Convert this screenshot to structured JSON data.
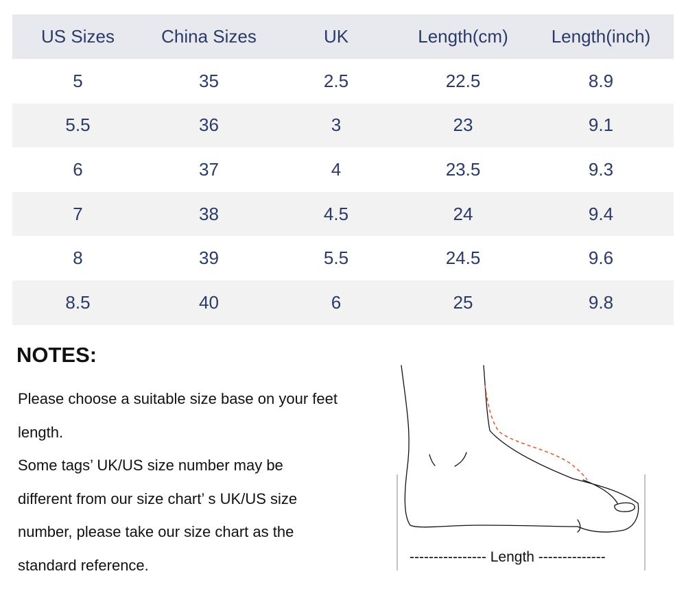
{
  "table": {
    "headers": [
      "US Sizes",
      "China Sizes",
      "UK",
      "Length(cm)",
      "Length(inch)"
    ],
    "rows": [
      [
        "5",
        "35",
        "2.5",
        "22.5",
        "8.9"
      ],
      [
        "5.5",
        "36",
        "3",
        "23",
        "9.1"
      ],
      [
        "6",
        "37",
        "4",
        "23.5",
        "9.3"
      ],
      [
        "7",
        "38",
        "4.5",
        "24",
        "9.4"
      ],
      [
        "8",
        "39",
        "5.5",
        "24.5",
        "9.6"
      ],
      [
        "8.5",
        "40",
        "6",
        "25",
        "9.8"
      ]
    ]
  },
  "notes": {
    "title": "NOTES:",
    "lines": [
      "Please choose a suitable size base on your feet",
      "length.",
      "Some tags’ UK/US size number may be",
      "different from our size chart’ s UK/US size",
      "number, please take our size chart as the",
      "standard reference."
    ]
  },
  "diagram": {
    "length_label": "---------------- Length --------------",
    "measure_line_color": "#e0552b"
  }
}
